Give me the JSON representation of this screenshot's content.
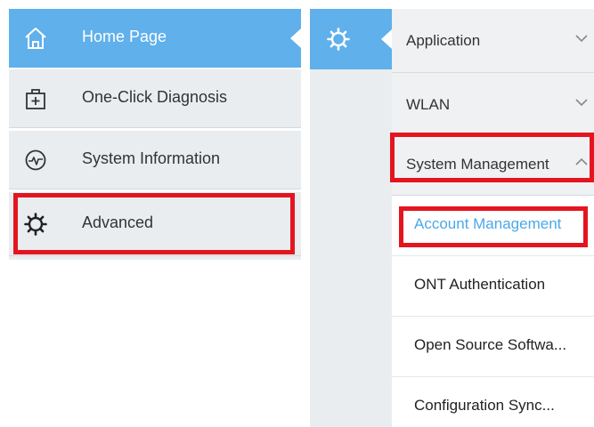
{
  "left_menu": {
    "items": [
      {
        "label": "Home Page",
        "icon": "home-icon",
        "active": true
      },
      {
        "label": "One-Click Diagnosis",
        "icon": "first-aid-kit-icon",
        "active": false
      },
      {
        "label": "System Information",
        "icon": "pulse-icon",
        "active": false
      },
      {
        "label": "Advanced",
        "icon": "gear-icon",
        "active": false
      }
    ]
  },
  "gear_strip": {
    "icon": "gear-icon"
  },
  "submenu": {
    "sections": [
      {
        "label": "Application",
        "expanded": false
      },
      {
        "label": "WLAN",
        "expanded": false
      },
      {
        "label": "System Management",
        "expanded": true
      }
    ],
    "children": [
      {
        "label": "Account Management",
        "selected": true
      },
      {
        "label": "ONT Authentication",
        "selected": false
      },
      {
        "label": "Open Source Softwa...",
        "selected": false
      },
      {
        "label": "Configuration Sync...",
        "selected": false
      }
    ]
  },
  "colors": {
    "accent": "#5fb0eb",
    "menu_bg": "#eaedf0",
    "highlight": "#e4151f",
    "selected_text": "#4aa8ea"
  }
}
